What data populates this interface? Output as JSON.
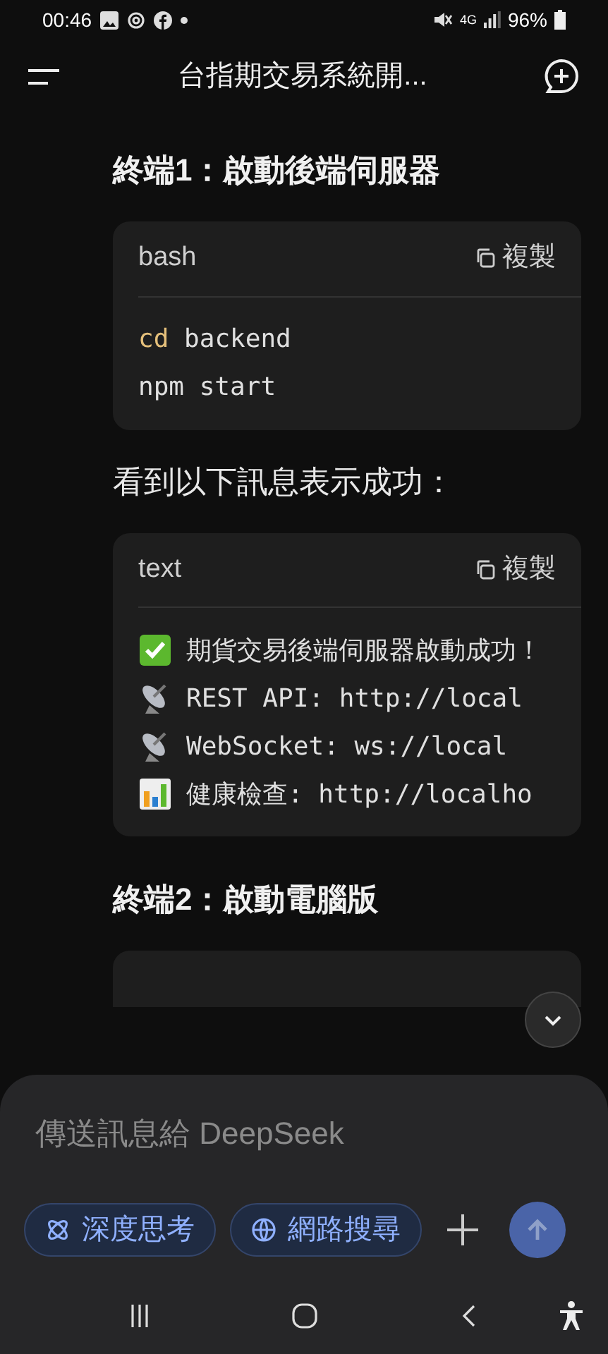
{
  "status_bar": {
    "time": "00:46",
    "network": "4G",
    "battery": "96%"
  },
  "header": {
    "title": "台指期交易系統開..."
  },
  "content": [
    {
      "kind": "heading",
      "text": "終端1：啟動後端伺服器"
    },
    {
      "kind": "code",
      "language": "bash",
      "copy_label": "複製",
      "lines": [
        {
          "parts": [
            {
              "text": "cd",
              "keyword": true
            },
            {
              "text": " backend",
              "keyword": false
            }
          ]
        },
        {
          "parts": [
            {
              "text": "npm start",
              "keyword": false
            }
          ]
        }
      ]
    },
    {
      "kind": "paragraph",
      "text": "看到以下訊息表示成功："
    },
    {
      "kind": "code",
      "language": "text",
      "copy_label": "複製",
      "lines": [
        {
          "kind": "success",
          "parts": [
            {
              "text": "期貨交易後端伺服器啟動成功！",
              "keyword": false
            }
          ]
        },
        {
          "kind": "endpoint",
          "parts": [
            {
              "text": "REST API: http://local",
              "keyword": false
            }
          ]
        },
        {
          "kind": "endpoint",
          "parts": [
            {
              "text": "WebSocket: ws://local",
              "keyword": false
            }
          ]
        },
        {
          "kind": "health",
          "parts": [
            {
              "text": "健康檢查: http://localho",
              "keyword": false
            }
          ]
        }
      ]
    },
    {
      "kind": "heading",
      "text": "終端2：啟動電腦版"
    },
    {
      "kind": "code_stub"
    }
  ],
  "composer": {
    "placeholder": "傳送訊息給 DeepSeek",
    "chips": [
      {
        "label": "深度思考",
        "selected": false
      },
      {
        "label": "網路搜尋",
        "selected": false
      }
    ]
  }
}
